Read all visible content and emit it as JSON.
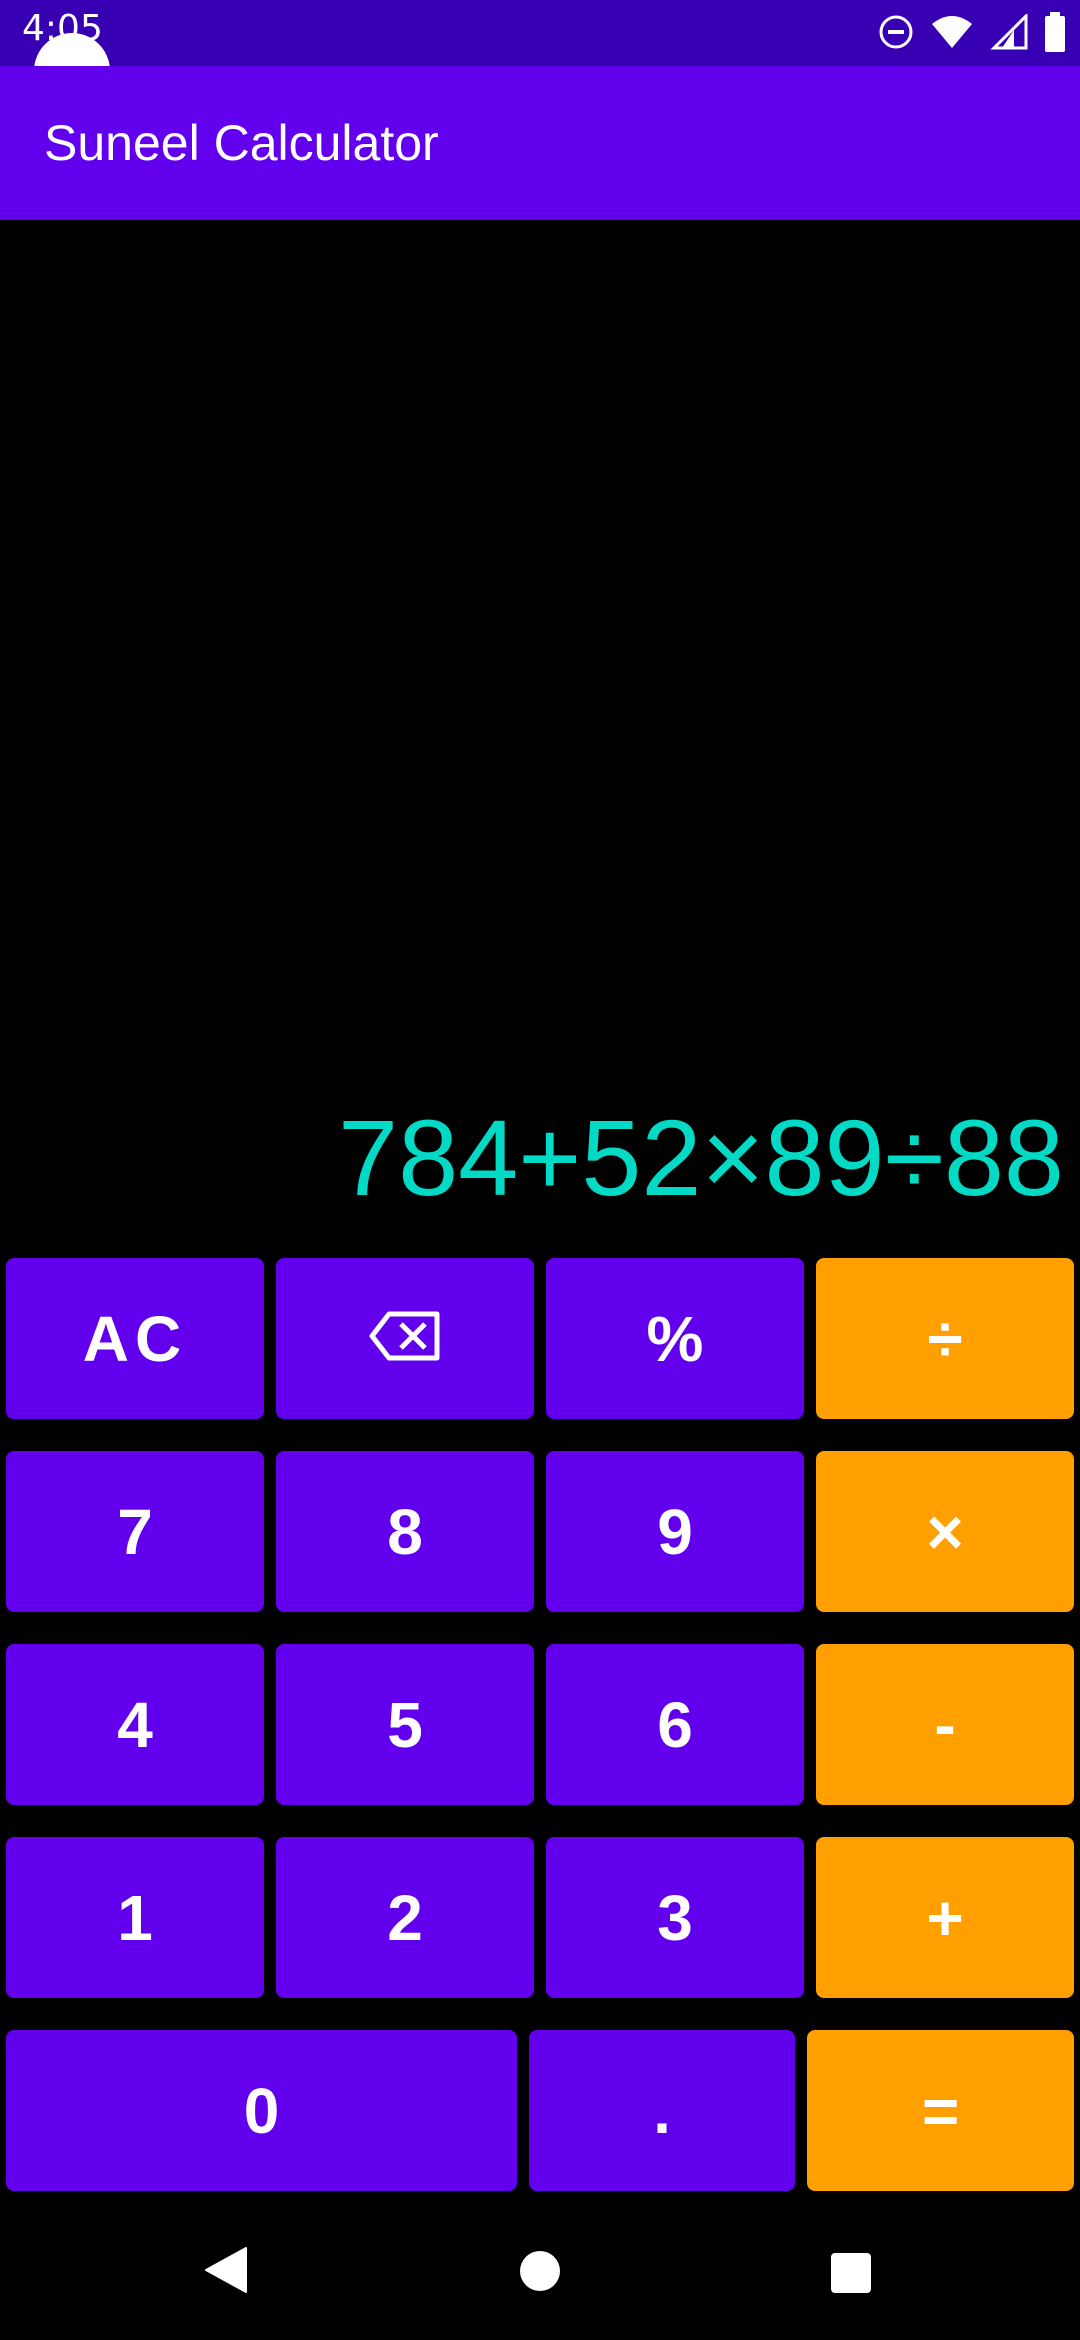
{
  "status_bar": {
    "time": "4:05",
    "icons": [
      "do-not-disturb-icon",
      "wifi-icon",
      "signal-icon",
      "battery-icon"
    ]
  },
  "app_bar": {
    "title": "Suneel Calculator"
  },
  "display": {
    "expression": "784+52×89÷88"
  },
  "keys": {
    "ac": "AC",
    "backspace": "backspace-icon",
    "percent": "%",
    "divide": "÷",
    "seven": "7",
    "eight": "8",
    "nine": "9",
    "multiply": "×",
    "four": "4",
    "five": "5",
    "six": "6",
    "minus": "-",
    "one": "1",
    "two": "2",
    "three": "3",
    "plus": "+",
    "zero": "0",
    "dot": ".",
    "equals": "="
  },
  "nav_bar": {
    "icons": [
      "back-icon",
      "home-icon",
      "recents-icon"
    ]
  },
  "colors": {
    "primary": "#6200EE",
    "primary_dark": "#3700B3",
    "operator": "#FF9F00",
    "display_text": "#03DAC5",
    "background": "#000000"
  }
}
